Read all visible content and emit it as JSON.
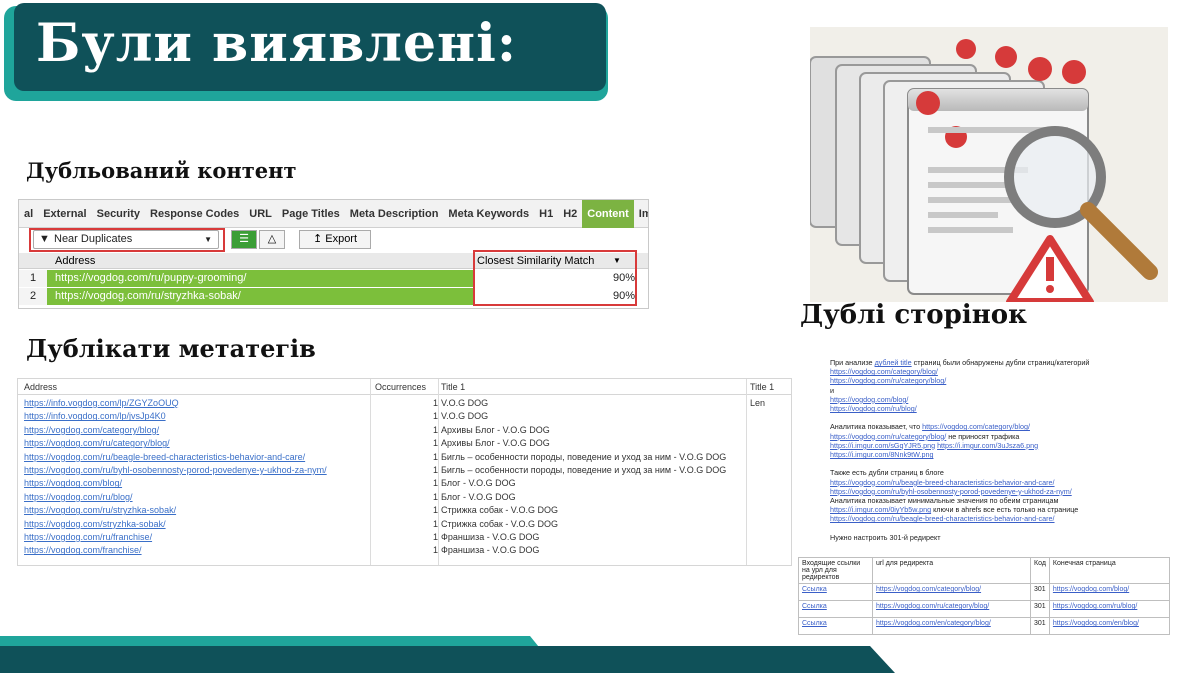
{
  "title": "Були виявлені:",
  "sections": {
    "duplicate_content": "Дубльований контент",
    "duplicate_meta": "Дублікати метатегів",
    "duplicate_pages": "Дублі сторінок"
  },
  "sf_panel": {
    "tabs": [
      "al",
      "External",
      "Security",
      "Response Codes",
      "URL",
      "Page Titles",
      "Meta Description",
      "Meta Keywords",
      "H1",
      "H2",
      "Content",
      "Images",
      "Ca"
    ],
    "active_tab": "Content",
    "filter": "Near Duplicates",
    "export_label": "Export",
    "col_address": "Address",
    "col_similarity": "Closest Similarity Match",
    "rows": [
      {
        "num": "1",
        "address": "https://vogdog.com/ru/puppy-grooming/",
        "pct": "90%"
      },
      {
        "num": "2",
        "address": "https://vogdog.com/ru/stryzhka-sobak/",
        "pct": "90%"
      }
    ]
  },
  "meta_table": {
    "headers": {
      "address": "Address",
      "occurrences": "Occurrences",
      "title1": "Title 1",
      "title1_len": "Title 1 Len"
    },
    "rows": [
      {
        "address": "https://info.vogdog.com/lp/ZGYZoOUQ",
        "occ": "1",
        "title": "V.O.G DOG"
      },
      {
        "address": "https://info.vogdog.com/lp/jvsJp4K0",
        "occ": "1",
        "title": "V.O.G DOG"
      },
      {
        "address": "https://vogdog.com/category/blog/",
        "occ": "1",
        "title": "Архивы Блог - V.O.G DOG"
      },
      {
        "address": "https://vogdog.com/ru/category/blog/",
        "occ": "1",
        "title": "Архивы Блог - V.O.G DOG"
      },
      {
        "address": "https://vogdog.com/ru/beagle-breed-characteristics-behavior-and-care/",
        "occ": "1",
        "title": "Бигль – особенности породы, поведение и уход за ним - V.O.G DOG"
      },
      {
        "address": "https://vogdog.com/ru/byhl-osobennosty-porod-povedenye-y-ukhod-za-nym/",
        "occ": "1",
        "title": "Бигль – особенности породы, поведение и уход за ним - V.O.G DOG"
      },
      {
        "address": "https://vogdog.com/blog/",
        "occ": "1",
        "title": "Блог - V.O.G DOG"
      },
      {
        "address": "https://vogdog.com/ru/blog/",
        "occ": "1",
        "title": "Блог - V.O.G DOG"
      },
      {
        "address": "https://vogdog.com/ru/stryzhka-sobak/",
        "occ": "1",
        "title": "Стрижка собак - V.O.G DOG"
      },
      {
        "address": "https://vogdog.com/stryzhka-sobak/",
        "occ": "1",
        "title": "Стрижка собак - V.O.G DOG"
      },
      {
        "address": "https://vogdog.com/ru/franchise/",
        "occ": "1",
        "title": "Франшиза - V.O.G DOG"
      },
      {
        "address": "https://vogdog.com/franchise/",
        "occ": "1",
        "title": "Франшиза - V.O.G DOG"
      }
    ]
  },
  "doc": {
    "lines": [
      {
        "t": "При анализе ",
        "link": "дублей title",
        "rest": " страниц были обнаружены дубли страниц/категорий"
      },
      {
        "link": "https://vogdog.com/category/blog/"
      },
      {
        "link": "https://vogdog.com/ru/category/blog/"
      },
      {
        "t": "и"
      },
      {
        "link": "https://vogdog.com/blog/"
      },
      {
        "link": "https://vogdog.com/ru/blog/"
      },
      {
        "t": ""
      },
      {
        "t": "Аналитика показывает, что ",
        "link": "https://vogdog.com/category/blog/"
      },
      {
        "link": "https://vogdog.com/ru/category/blog/",
        "rest": " не приносят трафика"
      },
      {
        "link": "https://i.imgur.com/sGqYJR5.png",
        "rest2": "https://i.imgur.com/3uJsza6.png"
      },
      {
        "link": "https://i.imgur.com/8Nnk9tW.png"
      },
      {
        "t": ""
      },
      {
        "t": "Также есть дубли страниц в блоге"
      },
      {
        "link": "https://vogdog.com/ru/beagle-breed-characteristics-behavior-and-care/"
      },
      {
        "link": "https://vogdog.com/ru/byhl-osobennosty-porod-povedenye-y-ukhod-za-nym/"
      },
      {
        "t": "Аналитика показывает минимальные значения по обеим страницам"
      },
      {
        "link": "https://i.imgur.com/0iyYb5w.png",
        "rest": " ключи в ahrefs все есть только на странице"
      },
      {
        "link": "https://vogdog.com/ru/beagle-breed-characteristics-behavior-and-care/"
      },
      {
        "t": ""
      },
      {
        "t": "Нужно настроить 301-й редирект"
      }
    ],
    "table_head": [
      "Входящие ссылки на урл для редиректов",
      "url для редиректа",
      "Код",
      "Конечная страница"
    ],
    "table_rows": [
      [
        "Ссылка",
        "https://vogdog.com/category/blog/",
        "301",
        "https://vogdog.com/blog/"
      ],
      [
        "Ссылка",
        "https://vogdog.com/ru/category/blog/",
        "301",
        "https://vogdog.com/ru/blog/"
      ],
      [
        "Ссылка",
        "https://vogdog.com/en/category/blog/",
        "301",
        "https://vogdog.com/en/blog/"
      ]
    ]
  },
  "colors": {
    "title_bg": "#0f5159",
    "accent": "#1fa59b",
    "green": "#7cbf3b",
    "red": "#d83a3a"
  }
}
